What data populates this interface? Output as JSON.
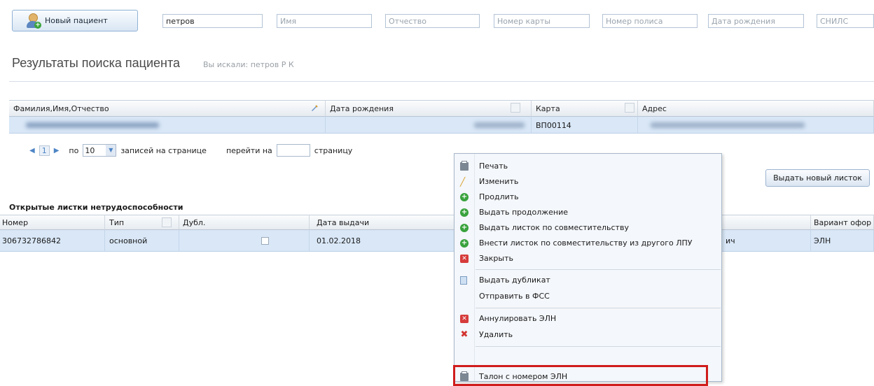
{
  "toolbar": {
    "new_patient_label": "Новый пациент",
    "lastname_value": "петров",
    "firstname_placeholder": "Имя",
    "patronymic_placeholder": "Отчество",
    "card_placeholder": "Номер карты",
    "policy_placeholder": "Номер полиса",
    "birthdate_placeholder": "Дата рождения",
    "snils_placeholder": "СНИЛС"
  },
  "search": {
    "title": "Результаты поиска пациента",
    "subtitle": "Вы искали: петров Р К"
  },
  "results": {
    "columns": [
      "Фамилия,Имя,Отчество",
      "Дата рождения",
      "Карта",
      "Адрес"
    ],
    "row": {
      "card": "ВП00114"
    }
  },
  "pager": {
    "page": "1",
    "per_page_prefix": "по",
    "per_page": "10",
    "per_page_suffix": "записей на странице",
    "goto_prefix": "перейти на",
    "goto_suffix": "страницу"
  },
  "actions": {
    "issue_new_label": "Выдать новый листок"
  },
  "sick_leaves": {
    "section_title": "Открытые листки нетрудоспособности",
    "columns": [
      "Номер",
      "Тип",
      "Дубл.",
      "Дата выдачи",
      "Вариант офор"
    ],
    "row": {
      "number": "306732786842",
      "type": "основной",
      "issue_date": "01.02.2018",
      "doctor_tail": "ич",
      "variant": "ЭЛН"
    }
  },
  "context_menu": {
    "items": [
      {
        "label": "Печать",
        "icon": "printer-icon"
      },
      {
        "label": "Изменить",
        "icon": "pencil-icon"
      },
      {
        "label": "Продлить",
        "icon": "plus-circle-icon"
      },
      {
        "label": "Выдать продолжение",
        "icon": "plus-circle-icon"
      },
      {
        "label": "Выдать листок по совместительству",
        "icon": "plus-circle-icon"
      },
      {
        "label": "Внести листок по совместительству из другого ЛПУ",
        "icon": "plus-circle-icon"
      },
      {
        "label": "Закрыть",
        "icon": "close-square-icon"
      },
      {
        "label": "Выдать дубликат",
        "icon": "document-icon"
      },
      {
        "label": "Отправить в ФСС",
        "icon": ""
      },
      {
        "label": "Аннулировать ЭЛН",
        "icon": "close-square-icon"
      },
      {
        "label": "Удалить",
        "icon": "delete-x-icon"
      },
      {
        "label": "Талон с номером ЭЛН",
        "icon": "printer-icon"
      }
    ]
  },
  "colors": {
    "selected_row": "#d9e7f7",
    "highlight_border": "#d01c1c",
    "menu_bg": "#f4f7fb"
  }
}
